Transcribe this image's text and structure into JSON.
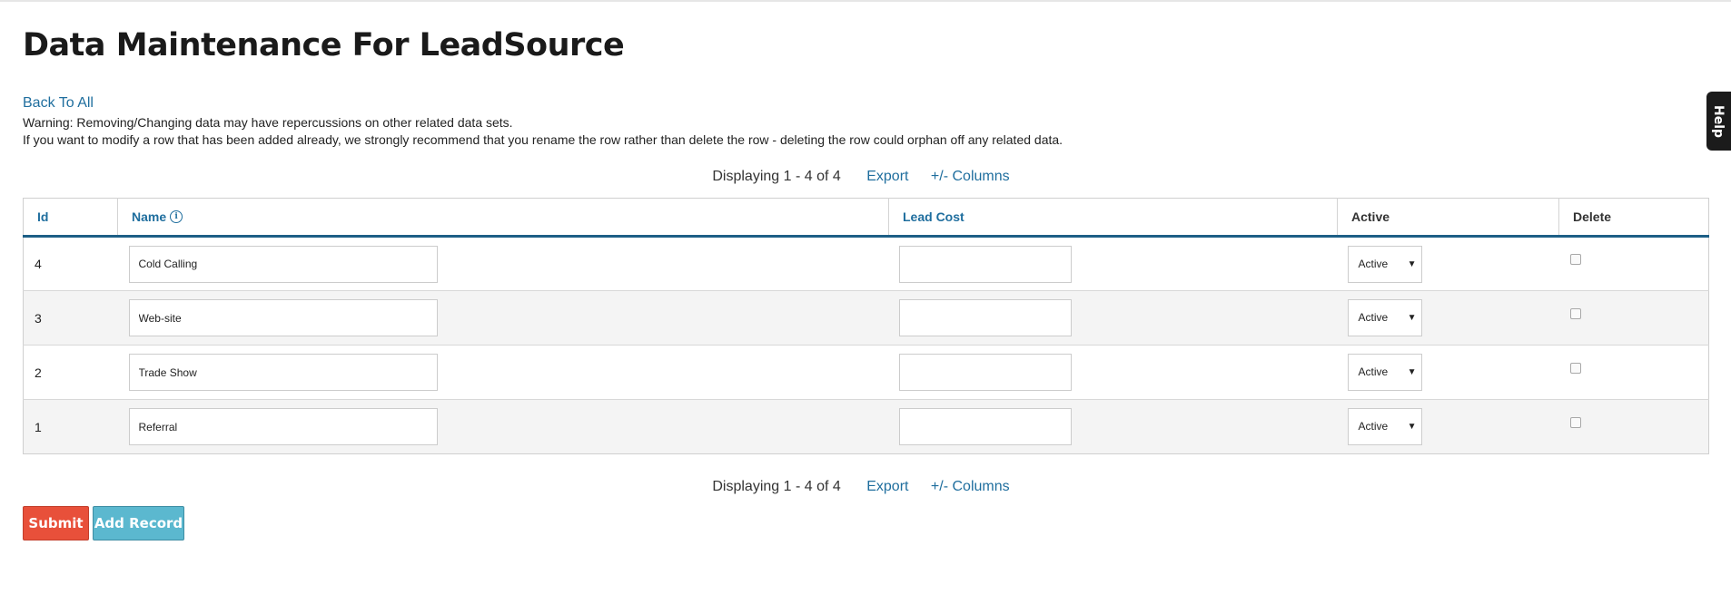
{
  "page": {
    "title": "Data Maintenance For LeadSource",
    "back_link": "Back To All",
    "warning_line1": "Warning: Removing/Changing data may have repercussions on other related data sets.",
    "warning_line2": "If you want to modify a row that has been added already, we strongly recommend that you rename the row rather than delete the row - deleting the row could orphan off any related data."
  },
  "pager": {
    "count": "Displaying 1 - 4 of 4",
    "export": "Export",
    "columns": "+/- Columns"
  },
  "table": {
    "headers": {
      "id": "Id",
      "name": "Name",
      "lead_cost": "Lead Cost",
      "active": "Active",
      "delete": "Delete"
    },
    "rows": [
      {
        "id": "4",
        "name": "Cold Calling",
        "lead_cost": "",
        "active": "Active",
        "delete": false
      },
      {
        "id": "3",
        "name": "Web-site",
        "lead_cost": "",
        "active": "Active",
        "delete": false
      },
      {
        "id": "2",
        "name": "Trade Show",
        "lead_cost": "",
        "active": "Active",
        "delete": false
      },
      {
        "id": "1",
        "name": "Referral",
        "lead_cost": "",
        "active": "Active",
        "delete": false
      }
    ]
  },
  "buttons": {
    "submit": "Submit",
    "add_record": "Add Record"
  },
  "help_tab": "Help",
  "colors": {
    "link": "#1f6e9e",
    "header_rule": "#1d5f86",
    "submit_bg": "#e8503a",
    "add_bg": "#5bb8cf"
  },
  "icons": {
    "info": "info-circle-icon",
    "dropdown": "caret-down-icon"
  }
}
